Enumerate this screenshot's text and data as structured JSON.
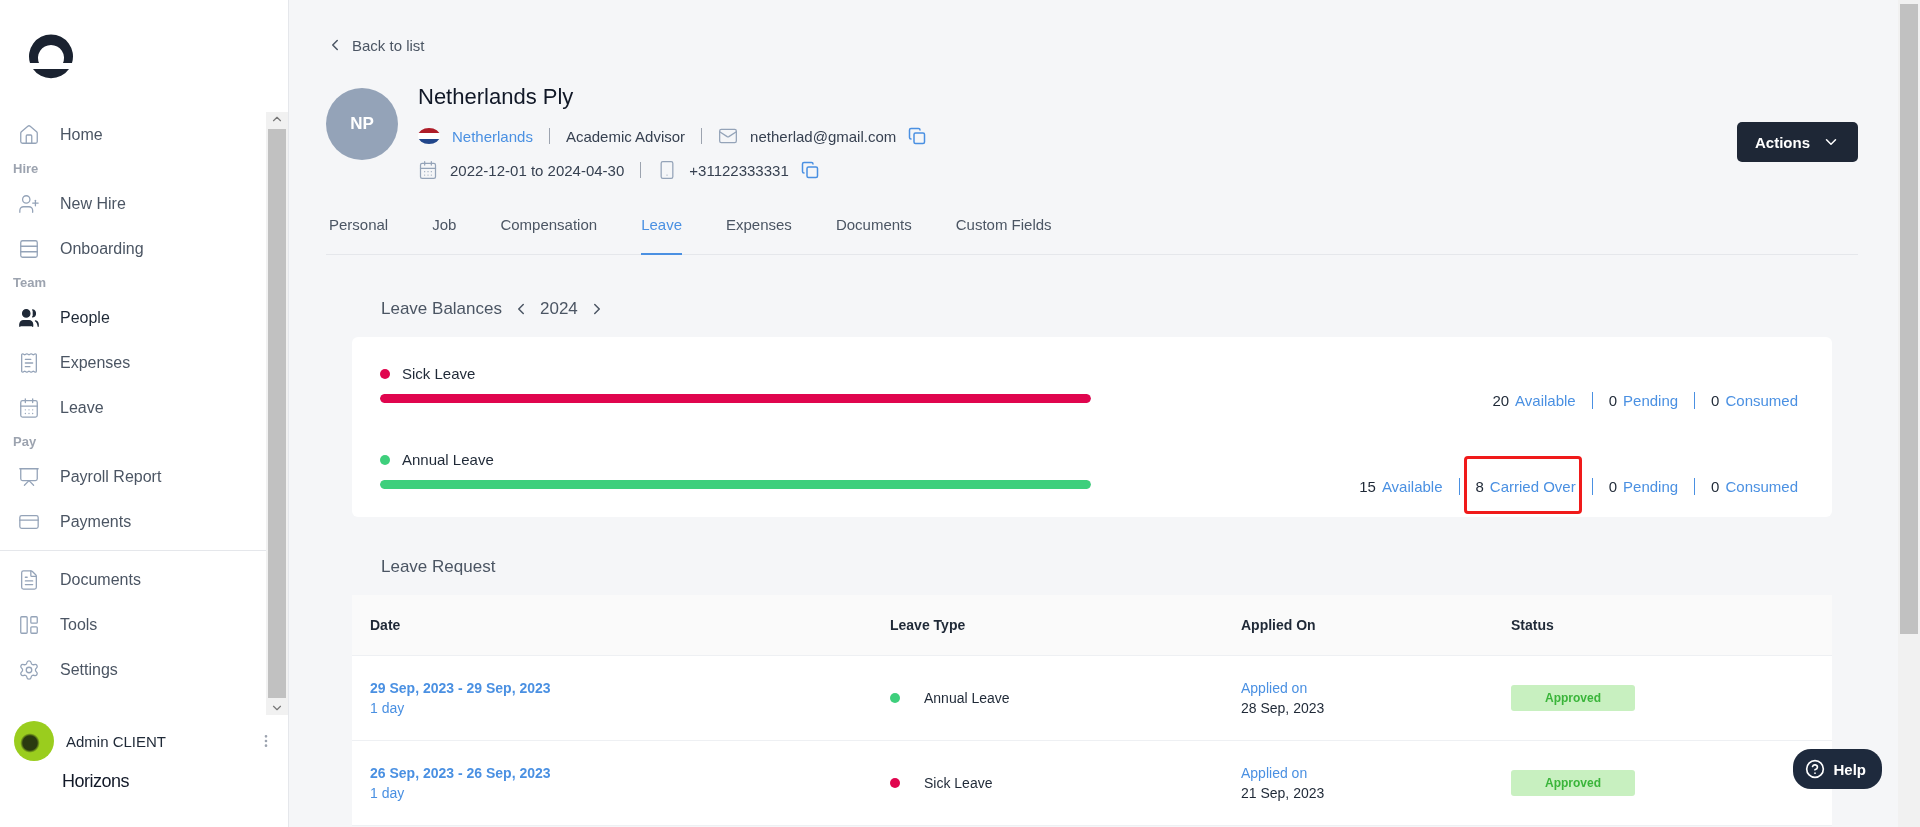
{
  "sidebar": {
    "items": [
      {
        "kind": "item",
        "label": "Home",
        "selected": false
      },
      {
        "kind": "section",
        "label": "Hire"
      },
      {
        "kind": "item",
        "label": "New Hire",
        "selected": false
      },
      {
        "kind": "item",
        "label": "Onboarding",
        "selected": false
      },
      {
        "kind": "section",
        "label": "Team"
      },
      {
        "kind": "item",
        "label": "People",
        "selected": true
      },
      {
        "kind": "item",
        "label": "Expenses",
        "selected": false
      },
      {
        "kind": "item",
        "label": "Leave",
        "selected": false
      },
      {
        "kind": "section",
        "label": "Pay"
      },
      {
        "kind": "item",
        "label": "Payroll Report",
        "selected": false
      },
      {
        "kind": "item",
        "label": "Payments",
        "selected": false
      },
      {
        "kind": "divider"
      },
      {
        "kind": "item",
        "label": "Documents",
        "selected": false
      },
      {
        "kind": "item",
        "label": "Tools",
        "selected": false
      },
      {
        "kind": "item",
        "label": "Settings",
        "selected": false
      }
    ],
    "user": {
      "name": "Admin CLIENT"
    },
    "brand": "Horizons"
  },
  "back_link": "Back to list",
  "profile": {
    "initials": "NP",
    "name": "Netherlands Ply",
    "country": "Netherlands",
    "role": "Academic Advisor",
    "email": "netherlad@gmail.com",
    "period": "2022-12-01 to 2024-04-30",
    "phone": "+31122333331"
  },
  "actions_button": "Actions",
  "tabs": [
    {
      "label": "Personal",
      "selected": false
    },
    {
      "label": "Job",
      "selected": false
    },
    {
      "label": "Compensation",
      "selected": false
    },
    {
      "label": "Leave",
      "selected": true
    },
    {
      "label": "Expenses",
      "selected": false
    },
    {
      "label": "Documents",
      "selected": false
    },
    {
      "label": "Custom Fields",
      "selected": false
    }
  ],
  "leave_balances": {
    "title": "Leave Balances",
    "year": "2024",
    "types": [
      {
        "name": "Sick Leave",
        "color": "#e0054e",
        "level": 1,
        "stats": [
          {
            "value": "20",
            "label": "Available",
            "highlighted": false
          },
          {
            "value": "0",
            "label": "Pending",
            "highlighted": false
          },
          {
            "value": "0",
            "label": "Consumed",
            "highlighted": false
          }
        ]
      },
      {
        "name": "Annual Leave",
        "color": "#3ecf7c",
        "level": 1,
        "stats": [
          {
            "value": "15",
            "label": "Available",
            "highlighted": false
          },
          {
            "value": "8",
            "label": "Carried Over",
            "highlighted": true
          },
          {
            "value": "0",
            "label": "Pending",
            "highlighted": false
          },
          {
            "value": "0",
            "label": "Consumed",
            "highlighted": false
          }
        ]
      }
    ]
  },
  "leave_request": {
    "title": "Leave Request",
    "columns": [
      "Date",
      "Leave Type",
      "Applied On",
      "Status"
    ],
    "rows": [
      {
        "dates": "29 Sep, 2023 - 29 Sep, 2023",
        "duration": "1 day",
        "type": "Annual Leave",
        "color": "#3ecf7c",
        "applied_label": "Applied on",
        "applied_date": "28 Sep, 2023",
        "status": "Approved"
      },
      {
        "dates": "26 Sep, 2023 - 26 Sep, 2023",
        "duration": "1 day",
        "type": "Sick Leave",
        "color": "#e0054e",
        "applied_label": "Applied on",
        "applied_date": "21 Sep, 2023",
        "status": "Approved"
      }
    ]
  },
  "help_button": "Help"
}
